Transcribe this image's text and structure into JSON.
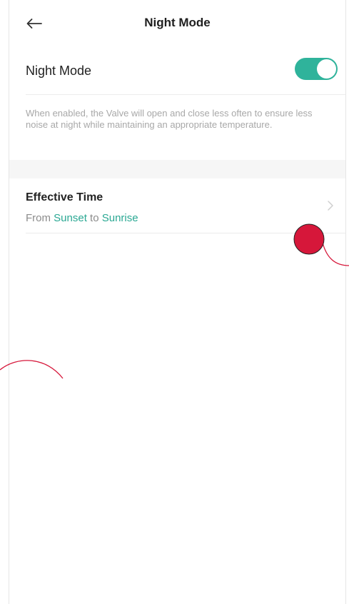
{
  "header": {
    "back_icon": "arrow-left-icon",
    "title": "Night Mode"
  },
  "night_mode": {
    "label": "Night Mode",
    "enabled": true,
    "toggle_color": "#2fb39b"
  },
  "description": "When enabled, the Valve will open and close less often to ensure less noise at night while maintaining an appropriate temperature.",
  "effective_time": {
    "title": "Effective Time",
    "from_label": "From",
    "start": "Sunset",
    "to_label": "to",
    "end": "Sunrise",
    "accent_color": "#2aa893",
    "chevron_icon": "chevron-right-icon"
  },
  "annotation": {
    "marker_color": "#d6173a"
  }
}
